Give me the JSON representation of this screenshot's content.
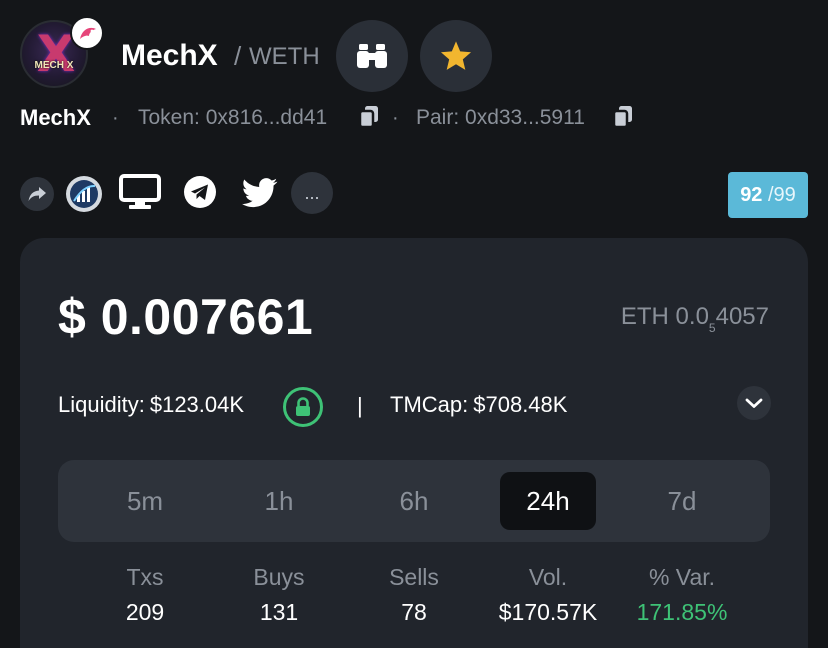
{
  "header": {
    "title": "MechX",
    "separator": "/",
    "pair_quote": "WETH",
    "logo_text": "MECH X",
    "icons": [
      "binoculars-icon",
      "star-icon",
      "dex-badge-icon"
    ]
  },
  "token_info": {
    "name": "MechX",
    "bullet": "·",
    "token_label": "Token: 0x816...dd41",
    "pair_label": "Pair: 0xd33...5911"
  },
  "social": {
    "icons": [
      "share-icon",
      "chart-logo-icon",
      "website-icon",
      "telegram-icon",
      "twitter-icon"
    ],
    "more_label": "...",
    "score": "92",
    "score_max": "/99"
  },
  "price": {
    "usd": "$ 0.007661",
    "eth_prefix": "ETH 0.0",
    "eth_sub": "5",
    "eth_suffix": "4057"
  },
  "liquidity": {
    "label": "Liquidity:",
    "value": "$123.04K",
    "divider": "|",
    "tmcap_label": "TMCap:",
    "tmcap_value": "$708.48K"
  },
  "timeframes": {
    "tabs": [
      "5m",
      "1h",
      "6h",
      "24h",
      "7d"
    ],
    "active": "24h"
  },
  "stats": {
    "txs_label": "Txs",
    "txs_value": "209",
    "buys_label": "Buys",
    "buys_value": "131",
    "sells_label": "Sells",
    "sells_value": "78",
    "vol_label": "Vol.",
    "vol_value": "$170.57K",
    "var_label": "% Var.",
    "var_value": "171.85%"
  },
  "colors": {
    "background": "#141619",
    "card": "#21252c",
    "accent_green": "#3ec276",
    "score_badge": "#5bb9d8",
    "star": "#f2b62f"
  }
}
